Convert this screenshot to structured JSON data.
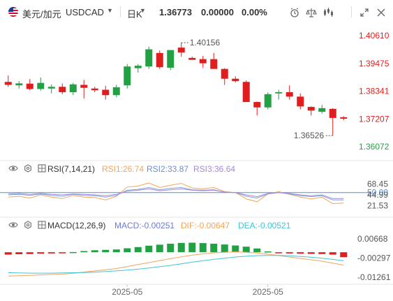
{
  "header": {
    "pair": "美元/加元",
    "symbol": "USDCAD",
    "period": "日K",
    "price": "1.36773",
    "change": "0.00000",
    "change_pct": "0.00%"
  },
  "toolbar_icons": [
    "alarm-clock-icon",
    "scale-icon",
    "candlestick-settings-icon",
    "expand-icon",
    "close-icon"
  ],
  "colors": {
    "up": "#21a143",
    "down": "#e21d1d",
    "rsi1": "#f5a45a",
    "rsi2": "#7aa0d8",
    "rsi3": "#a688d9",
    "macd": "#6a7bd8",
    "dif": "#f5a45a",
    "dea": "#43c3d3",
    "rsi_line": "#4a90e2"
  },
  "chart_data": [
    {
      "type": "candlestick",
      "series_name": "USDCAD",
      "y_ticks": [
        "1.40610",
        "1.39475",
        "1.38341",
        "1.37207",
        "1.36072"
      ],
      "ylim": [
        1.3585,
        1.4078
      ],
      "annotations": {
        "high": "1.40156",
        "low": "1.36526"
      },
      "candles": [
        {
          "o": 1.3872,
          "h": 1.3898,
          "l": 1.3852,
          "c": 1.386
        },
        {
          "o": 1.3858,
          "h": 1.3875,
          "l": 1.3845,
          "c": 1.3866
        },
        {
          "o": 1.3865,
          "h": 1.3884,
          "l": 1.3838,
          "c": 1.3843
        },
        {
          "o": 1.3843,
          "h": 1.389,
          "l": 1.3836,
          "c": 1.3868
        },
        {
          "o": 1.3845,
          "h": 1.3862,
          "l": 1.3825,
          "c": 1.3852
        },
        {
          "o": 1.3852,
          "h": 1.3866,
          "l": 1.3822,
          "c": 1.383
        },
        {
          "o": 1.383,
          "h": 1.3868,
          "l": 1.3818,
          "c": 1.3862
        },
        {
          "o": 1.386,
          "h": 1.388,
          "l": 1.3805,
          "c": 1.3848
        },
        {
          "o": 1.3845,
          "h": 1.3852,
          "l": 1.383,
          "c": 1.3838
        },
        {
          "o": 1.384,
          "h": 1.3856,
          "l": 1.38,
          "c": 1.3818
        },
        {
          "o": 1.3818,
          "h": 1.386,
          "l": 1.381,
          "c": 1.385
        },
        {
          "o": 1.3858,
          "h": 1.3945,
          "l": 1.3845,
          "c": 1.3935
        },
        {
          "o": 1.3928,
          "h": 1.3945,
          "l": 1.391,
          "c": 1.3938
        },
        {
          "o": 1.3935,
          "h": 1.4016,
          "l": 1.3925,
          "c": 1.4005
        },
        {
          "o": 1.399,
          "h": 1.4,
          "l": 1.3925,
          "c": 1.3932
        },
        {
          "o": 1.393,
          "h": 1.3992,
          "l": 1.392,
          "c": 1.4002
        },
        {
          "o": 1.4012,
          "h": 1.4032,
          "l": 1.3975,
          "c": 1.3992
        },
        {
          "o": 1.397,
          "h": 1.3975,
          "l": 1.3962,
          "c": 1.3962
        },
        {
          "o": 1.3965,
          "h": 1.3978,
          "l": 1.393,
          "c": 1.3948
        },
        {
          "o": 1.3965,
          "h": 1.399,
          "l": 1.395,
          "c": 1.3925
        },
        {
          "o": 1.3925,
          "h": 1.3928,
          "l": 1.386,
          "c": 1.3885
        },
        {
          "o": 1.3885,
          "h": 1.3895,
          "l": 1.387,
          "c": 1.3875
        },
        {
          "o": 1.3872,
          "h": 1.3878,
          "l": 1.379,
          "c": 1.379
        },
        {
          "o": 1.379,
          "h": 1.3792,
          "l": 1.3735,
          "c": 1.3768
        },
        {
          "o": 1.3768,
          "h": 1.383,
          "l": 1.376,
          "c": 1.3822
        },
        {
          "o": 1.3825,
          "h": 1.384,
          "l": 1.38,
          "c": 1.383
        },
        {
          "o": 1.383,
          "h": 1.3858,
          "l": 1.38,
          "c": 1.3812
        },
        {
          "o": 1.3812,
          "h": 1.3825,
          "l": 1.376,
          "c": 1.3772
        },
        {
          "o": 1.377,
          "h": 1.3772,
          "l": 1.3735,
          "c": 1.3755
        },
        {
          "o": 1.375,
          "h": 1.3778,
          "l": 1.3743,
          "c": 1.3765
        },
        {
          "o": 1.3762,
          "h": 1.3765,
          "l": 1.3653,
          "c": 1.3725
        },
        {
          "o": 1.3728,
          "h": 1.3732,
          "l": 1.3715,
          "c": 1.3722
        }
      ]
    },
    {
      "type": "line",
      "title": "RSI(7,14,21)",
      "legend": [
        "RSI1:26.74",
        "RSI2:33.87",
        "RSI3:36.64"
      ],
      "y_ticks": [
        "68.45",
        "50.00",
        "44.99",
        "21.53"
      ],
      "ylim": [
        10,
        80
      ],
      "ref_value": 50,
      "series": [
        {
          "name": "RSI1",
          "values": [
            40,
            42,
            38,
            45,
            40,
            37,
            44,
            40,
            39,
            34,
            42,
            62,
            64,
            71,
            61,
            66,
            70,
            60,
            58,
            61,
            52,
            50,
            36,
            30,
            47,
            52,
            46,
            40,
            36,
            40,
            26,
            27
          ]
        },
        {
          "name": "RSI2",
          "values": [
            45,
            46,
            44,
            47,
            44,
            42,
            46,
            44,
            43,
            40,
            44,
            55,
            57,
            61,
            56,
            59,
            61,
            56,
            55,
            56,
            51,
            50,
            42,
            38,
            47,
            50,
            47,
            43,
            41,
            43,
            34,
            34
          ]
        },
        {
          "name": "RSI3",
          "values": [
            47,
            48,
            46,
            48,
            46,
            45,
            47,
            46,
            45,
            43,
            46,
            53,
            55,
            58,
            54,
            56,
            58,
            55,
            54,
            55,
            51,
            50,
            45,
            41,
            48,
            50,
            48,
            45,
            43,
            45,
            37,
            37
          ]
        }
      ]
    },
    {
      "type": "bar+line",
      "title": "MACD(12,26,9)",
      "legend": [
        "MACD:-0.00251",
        "DIF:-0.00647",
        "DEA:-0.00521"
      ],
      "y_ticks": [
        "0.00668",
        "-0.00297",
        "-0.01261"
      ],
      "ylim": [
        -0.0147,
        0.0085
      ],
      "x_ticks": [
        "2025-05",
        "2025-05"
      ],
      "macd": [
        -0.0012,
        -0.001,
        -0.0009,
        -0.0007,
        -0.0006,
        -0.0004,
        0.0001,
        0.0006,
        0.001,
        0.0012,
        0.0014,
        0.002,
        0.0026,
        0.0033,
        0.0038,
        0.0043,
        0.0047,
        0.0048,
        0.0046,
        0.0043,
        0.0039,
        0.0034,
        0.0028,
        0.0019,
        0.0004,
        -0.0002,
        -0.0006,
        -0.0007,
        -0.0008,
        -0.0009,
        -0.0012,
        -0.0025
      ],
      "dif": [
        -0.012,
        -0.0118,
        -0.0116,
        -0.0114,
        -0.0112,
        -0.011,
        -0.0106,
        -0.01,
        -0.0094,
        -0.0088,
        -0.0082,
        -0.0072,
        -0.0062,
        -0.0052,
        -0.0042,
        -0.0032,
        -0.0023,
        -0.0015,
        -0.0008,
        -0.0003,
        0.0,
        0.0002,
        0.0,
        -0.0004,
        -0.001,
        -0.0017,
        -0.0024,
        -0.0031,
        -0.0038,
        -0.0045,
        -0.0055,
        -0.0065
      ],
      "dea": [
        -0.0103,
        -0.0104,
        -0.0105,
        -0.0105,
        -0.0105,
        -0.0104,
        -0.0103,
        -0.0102,
        -0.01,
        -0.0097,
        -0.0094,
        -0.009,
        -0.0085,
        -0.0079,
        -0.0073,
        -0.0066,
        -0.0058,
        -0.005,
        -0.0043,
        -0.0036,
        -0.003,
        -0.0024,
        -0.002,
        -0.0017,
        -0.0016,
        -0.0016,
        -0.0018,
        -0.0021,
        -0.0025,
        -0.003,
        -0.0036,
        -0.0043
      ]
    }
  ]
}
